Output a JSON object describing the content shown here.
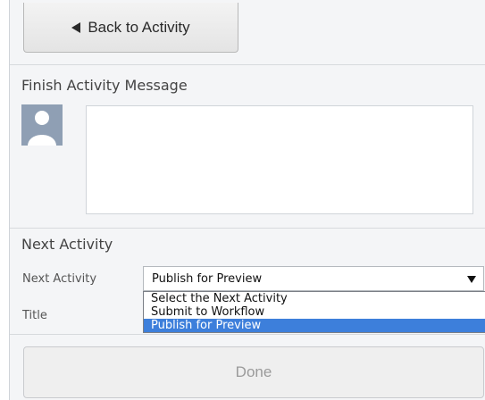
{
  "back_button": {
    "label": "Back to Activity",
    "icon": "triangle-left-icon"
  },
  "finish_message": {
    "title": "Finish Activity Message",
    "avatar_icon": "user-avatar-icon",
    "message_value": ""
  },
  "next_activity": {
    "title": "Next Activity",
    "field_label": "Next Activity",
    "selected_value": "Publish for Preview",
    "options": [
      "Select the Next Activity",
      "Submit to Workflow",
      "Publish for Preview"
    ],
    "highlighted_option": "Publish for Preview",
    "title_label": "Title"
  },
  "done_button": {
    "label": "Done",
    "state": "disabled"
  },
  "colors": {
    "panel_bg": "#f4f5f7",
    "highlight": "#3d7fdb",
    "avatar_bg": "#8f9fb4"
  }
}
